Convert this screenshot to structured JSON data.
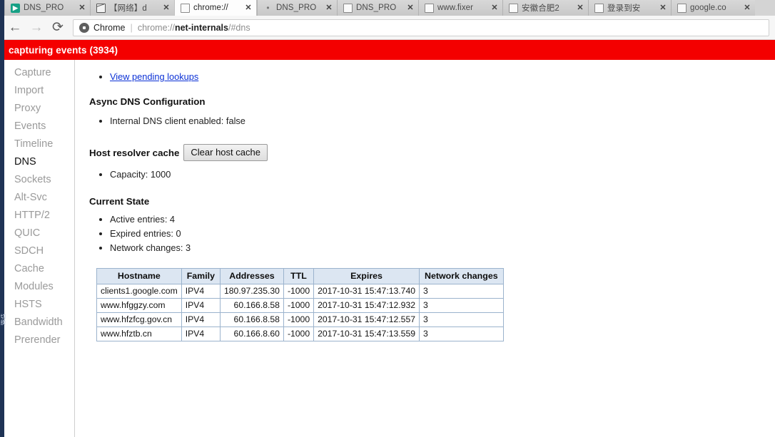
{
  "window": {
    "tabs": [
      {
        "title": "DNS_PRO",
        "favicon": "green-play-icon",
        "active": false
      },
      {
        "title": "【网络】d",
        "favicon": "mail-icon",
        "active": false
      },
      {
        "title": "chrome://",
        "favicon": "page-icon",
        "active": true
      },
      {
        "title": "DNS_PRO",
        "favicon": "dot-icon",
        "active": false
      },
      {
        "title": "DNS_PRO",
        "favicon": "page-icon",
        "active": false
      },
      {
        "title": "www.fixer",
        "favicon": "page-icon",
        "active": false
      },
      {
        "title": "安徽合肥2",
        "favicon": "page-icon",
        "active": false
      },
      {
        "title": "登录到安",
        "favicon": "page-icon",
        "active": false
      },
      {
        "title": "google.co",
        "favicon": "page-icon",
        "active": false
      }
    ],
    "tab_close_label": "✕"
  },
  "toolbar": {
    "back_label": "←",
    "forward_label": "→",
    "reload_label": "⟳",
    "security_chip": "Chrome",
    "separator": "|",
    "url_prefix": "chrome://",
    "url_bold": "net-internals",
    "url_suffix": "/#dns",
    "url_full": "chrome://net-internals/#dns"
  },
  "banner": {
    "text": "capturing events (3934)",
    "color": "#f40000"
  },
  "sidebar": {
    "items": [
      {
        "label": "Capture",
        "active": false
      },
      {
        "label": "Import",
        "active": false
      },
      {
        "label": "Proxy",
        "active": false
      },
      {
        "label": "Events",
        "active": false
      },
      {
        "label": "Timeline",
        "active": false
      },
      {
        "label": "DNS",
        "active": true
      },
      {
        "label": "Sockets",
        "active": false
      },
      {
        "label": "Alt-Svc",
        "active": false
      },
      {
        "label": "HTTP/2",
        "active": false
      },
      {
        "label": "QUIC",
        "active": false
      },
      {
        "label": "SDCH",
        "active": false
      },
      {
        "label": "Cache",
        "active": false
      },
      {
        "label": "Modules",
        "active": false
      },
      {
        "label": "HSTS",
        "active": false
      },
      {
        "label": "Bandwidth",
        "active": false
      },
      {
        "label": "Prerender",
        "active": false
      }
    ],
    "edge_glyph": "切换"
  },
  "main": {
    "pending_lookups_link": "View pending lookups",
    "async_heading": "Async DNS Configuration",
    "internal_client": "Internal DNS client enabled: false",
    "host_cache_label": "Host resolver cache",
    "clear_cache_button": "Clear host cache",
    "capacity": "Capacity: 1000",
    "current_state_heading": "Current State",
    "active_entries": "Active entries: 4",
    "expired_entries": "Expired entries: 0",
    "network_changes": "Network changes: 3",
    "table": {
      "columns": [
        "Hostname",
        "Family",
        "Addresses",
        "TTL",
        "Expires",
        "Network changes"
      ],
      "rows": [
        {
          "hostname": "clients1.google.com",
          "family": "IPV4",
          "addresses": "180.97.235.30",
          "ttl": "-1000",
          "expires": "2017-10-31 15:47:13.740",
          "network_changes": "3"
        },
        {
          "hostname": "www.hfggzy.com",
          "family": "IPV4",
          "addresses": "60.166.8.58",
          "ttl": "-1000",
          "expires": "2017-10-31 15:47:12.932",
          "network_changes": "3"
        },
        {
          "hostname": "www.hfzfcg.gov.cn",
          "family": "IPV4",
          "addresses": "60.166.8.58",
          "ttl": "-1000",
          "expires": "2017-10-31 15:47:12.557",
          "network_changes": "3"
        },
        {
          "hostname": "www.hfztb.cn",
          "family": "IPV4",
          "addresses": "60.166.8.60",
          "ttl": "-1000",
          "expires": "2017-10-31 15:47:13.559",
          "network_changes": "3"
        }
      ]
    }
  }
}
